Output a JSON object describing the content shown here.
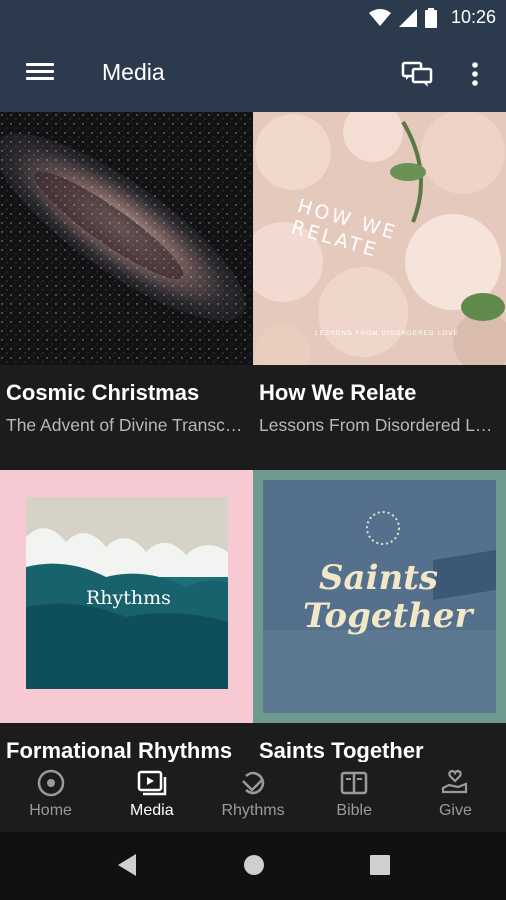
{
  "status": {
    "time": "10:26"
  },
  "header": {
    "title": "Media"
  },
  "cards": [
    {
      "title": "Cosmic Christmas",
      "subtitle": "The Advent of Divine Transcendence"
    },
    {
      "title": "How We Relate",
      "subtitle": "Lessons From Disordered Love",
      "art_heading": "HOW WE RELATE",
      "art_caption": "LESSONS FROM DISORDERED LOVE"
    },
    {
      "title": "Formational Rhythms",
      "art_heading": "Rhythms"
    },
    {
      "title": "Saints Together",
      "art_heading_1": "Saints",
      "art_heading_2": "Together"
    }
  ],
  "nav": [
    {
      "label": "Home",
      "icon": "home-icon"
    },
    {
      "label": "Media",
      "icon": "media-icon"
    },
    {
      "label": "Rhythms",
      "icon": "rhythms-icon"
    },
    {
      "label": "Bible",
      "icon": "bible-icon"
    },
    {
      "label": "Give",
      "icon": "give-icon"
    }
  ],
  "colors": {
    "appbar": "#2b3a4d",
    "background": "#1c1c1c",
    "pink": "#f6c9d3",
    "teal": "#6f9a8f"
  }
}
